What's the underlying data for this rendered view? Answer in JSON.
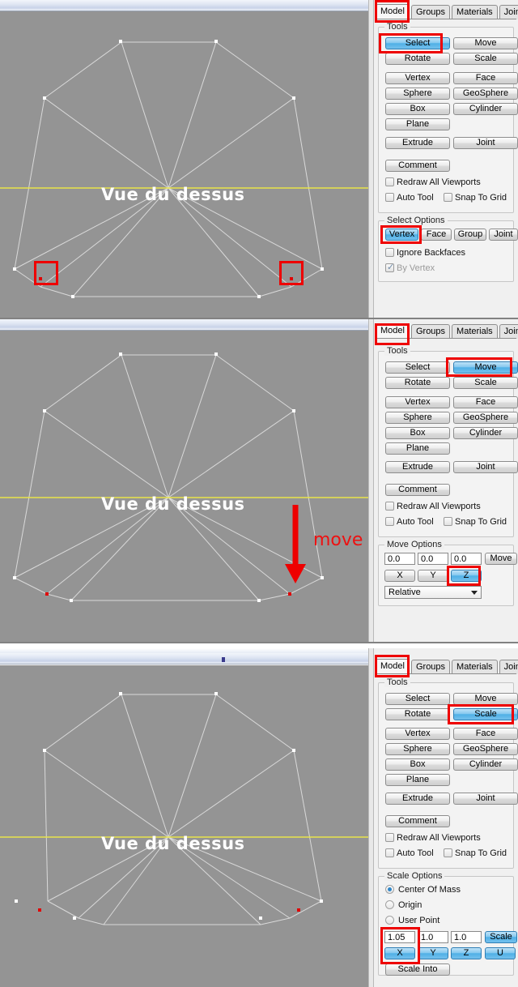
{
  "app": {
    "viewport_label": "Vue du dessus",
    "viewport_bg": "#949494",
    "wire_color": "#d9d9d9",
    "axis_color": "#e8e44a",
    "vertex_color": "#ffffff",
    "selected_vertex_color": "#e00000",
    "annotation_color": "#ee0000",
    "highlight_color": "#4fb0e6"
  },
  "tabs": [
    {
      "label": "Model",
      "active": true
    },
    {
      "label": "Groups",
      "active": false
    },
    {
      "label": "Materials",
      "active": false
    },
    {
      "label": "Joints",
      "active": false
    }
  ],
  "tools_group": {
    "title": "Tools",
    "buttons": [
      "Select",
      "Move",
      "Rotate",
      "Scale",
      "Vertex",
      "Face",
      "Sphere",
      "GeoSphere",
      "Box",
      "Cylinder",
      "Plane",
      "Extrude",
      "Joint"
    ],
    "comment_label": "Comment",
    "checkboxes": [
      {
        "label": "Redraw All Viewports",
        "checked": false
      },
      {
        "label": "Auto Tool",
        "checked": false
      },
      {
        "label": "Snap To Grid",
        "checked": false
      }
    ]
  },
  "select_options": {
    "title": "Select Options",
    "modes": [
      "Vertex",
      "Face",
      "Group",
      "Joint"
    ],
    "active_mode": "Vertex",
    "ignore_backfaces": {
      "label": "Ignore Backfaces",
      "checked": false
    },
    "by_vertex": {
      "label": "By Vertex",
      "checked": true,
      "disabled": true
    }
  },
  "move_options": {
    "title": "Move Options",
    "fields": [
      "0.0",
      "0.0",
      "0.0"
    ],
    "move_label": "Move",
    "axes": [
      "X",
      "Y",
      "Z"
    ],
    "active_axis": "Z",
    "mode": "Relative"
  },
  "scale_options": {
    "title": "Scale Options",
    "radios": [
      {
        "label": "Center Of Mass",
        "checked": true
      },
      {
        "label": "Origin",
        "checked": false
      },
      {
        "label": "User Point",
        "checked": false
      }
    ],
    "fields": [
      "1.05",
      "1.0",
      "1.0"
    ],
    "scale_label": "Scale",
    "axes": [
      "X",
      "Y",
      "Z",
      "U"
    ],
    "active_axis": "X",
    "scale_into_label": "Scale Into"
  },
  "panels": [
    {
      "step": 1,
      "active_tool": "Select",
      "annotations": {
        "vertex_boxes": 2,
        "highlight_targets": [
          "Model tab",
          "Select button",
          "Vertex select mode"
        ]
      }
    },
    {
      "step": 2,
      "active_tool": "Move",
      "annotations": {
        "arrow_label": "move",
        "highlight_targets": [
          "Model tab",
          "Move button",
          "Z axis button"
        ]
      }
    },
    {
      "step": 3,
      "active_tool": "Scale",
      "annotations": {
        "highlight_targets": [
          "Model tab",
          "Scale button",
          "X axis + scale value"
        ]
      }
    }
  ]
}
